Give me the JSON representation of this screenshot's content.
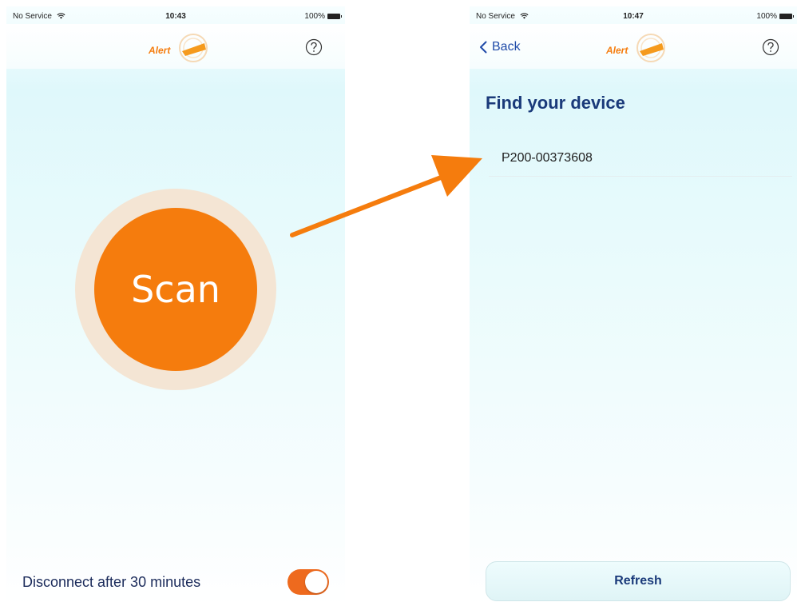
{
  "colors": {
    "accent_orange": "#f57c0d",
    "ring": "#f4e5d4",
    "heading_blue": "#1a3a7a",
    "link_blue": "#1f4aa8",
    "toggle_on": "#ee6a1e"
  },
  "left": {
    "status": {
      "carrier": "No Service",
      "time": "10:43",
      "battery": "100%"
    },
    "logo_text": "Alert",
    "help_icon": "question-circle-icon",
    "scan_label": "Scan",
    "disconnect_label": "Disconnect after 30 minutes",
    "disconnect_toggle_on": true
  },
  "right": {
    "status": {
      "carrier": "No Service",
      "time": "10:47",
      "battery": "100%"
    },
    "back_label": "Back",
    "logo_text": "Alert",
    "help_icon": "question-circle-icon",
    "heading": "Find your device",
    "devices": [
      "P200-00373608"
    ],
    "refresh_label": "Refresh"
  },
  "arrow_icon": "arrow-right-icon"
}
